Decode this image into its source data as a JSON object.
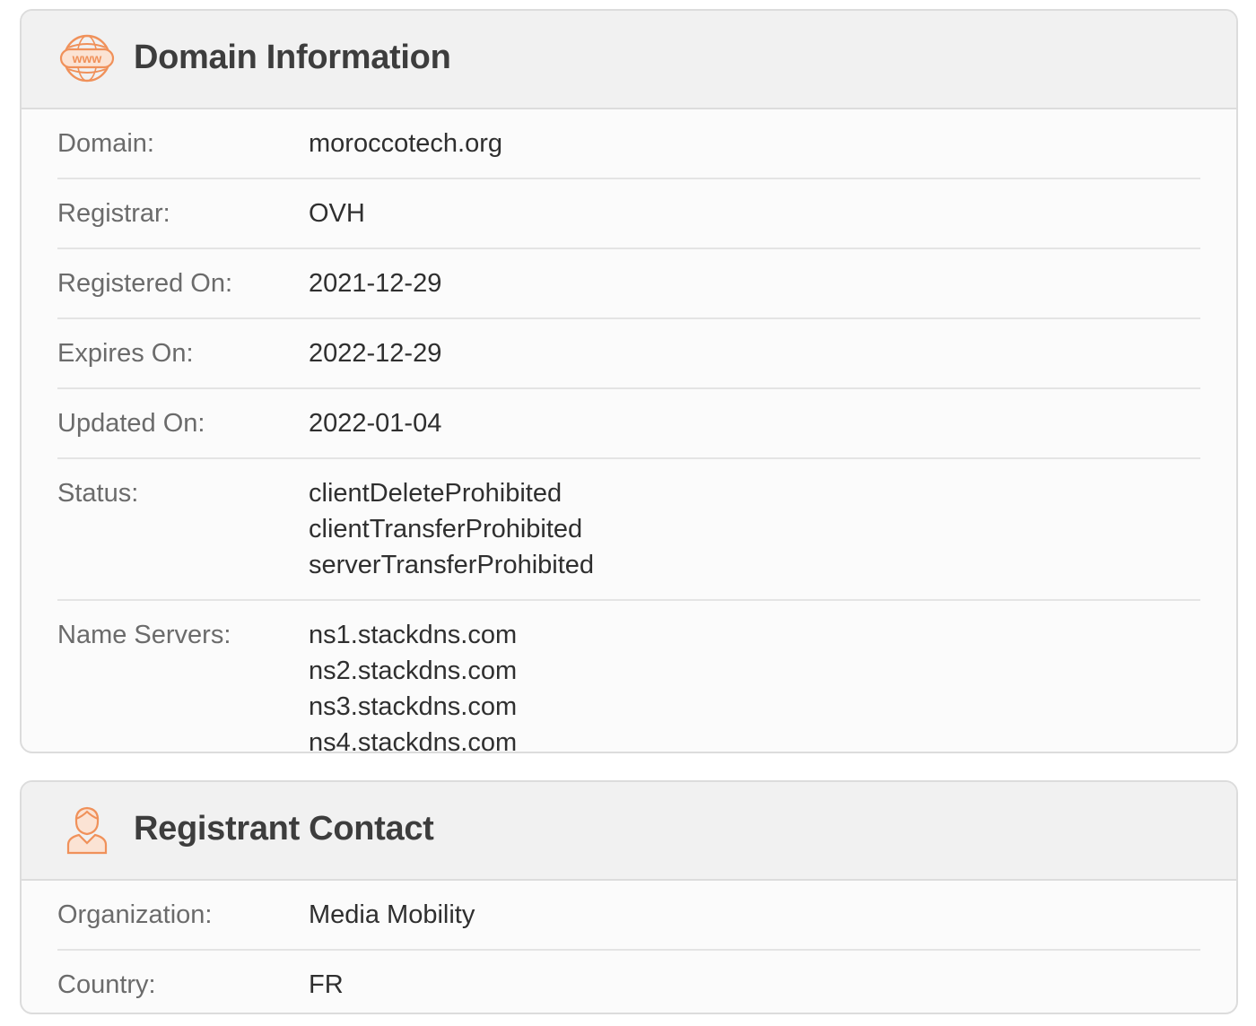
{
  "domain_information": {
    "title": "Domain Information",
    "icon": "www-globe-icon",
    "rows": {
      "domain": {
        "label": "Domain:",
        "value": "moroccotech.org"
      },
      "registrar": {
        "label": "Registrar:",
        "value": "OVH"
      },
      "registered_on": {
        "label": "Registered On:",
        "value": "2021-12-29"
      },
      "expires_on": {
        "label": "Expires On:",
        "value": "2022-12-29"
      },
      "updated_on": {
        "label": "Updated On:",
        "value": "2022-01-04"
      },
      "status": {
        "label": "Status:",
        "values": [
          "clientDeleteProhibited",
          "clientTransferProhibited",
          "serverTransferProhibited"
        ]
      },
      "name_servers": {
        "label": "Name Servers:",
        "values": [
          "ns1.stackdns.com",
          "ns2.stackdns.com",
          "ns3.stackdns.com",
          "ns4.stackdns.com"
        ]
      }
    }
  },
  "registrant_contact": {
    "title": "Registrant Contact",
    "icon": "person-icon",
    "rows": {
      "organization": {
        "label": "Organization:",
        "value": "Media Mobility"
      },
      "country": {
        "label": "Country:",
        "value": "FR"
      }
    }
  },
  "colors": {
    "accent_icon": "#f0915a",
    "header_bg": "#f1f1f1",
    "border": "#dcdcdc"
  }
}
